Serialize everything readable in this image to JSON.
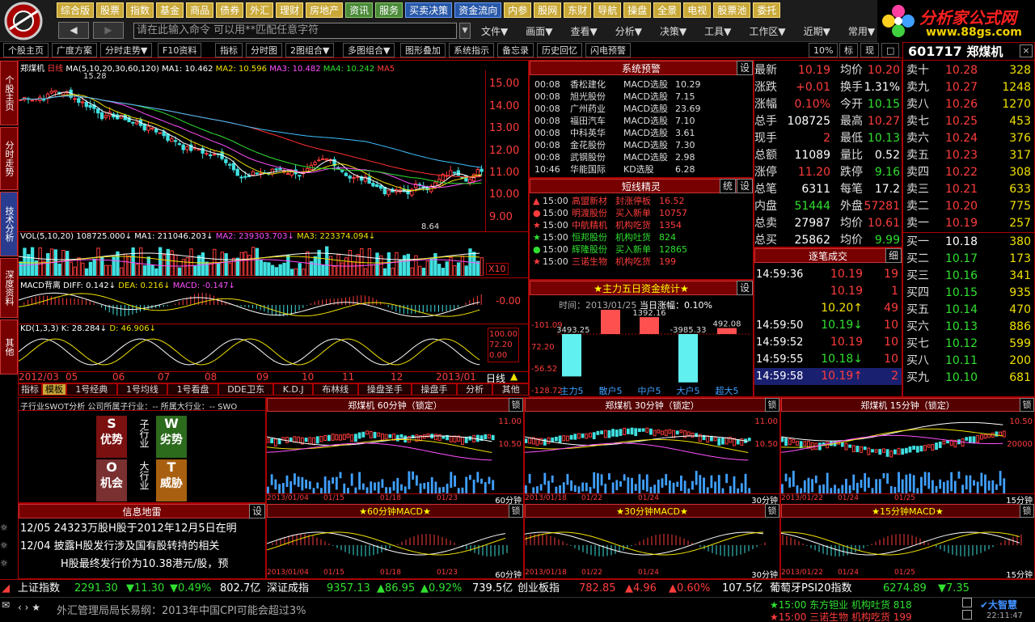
{
  "menu1": [
    "综合版",
    "股票",
    "指数",
    "基金",
    "商品",
    "债券",
    "外汇",
    "理财",
    "房地产",
    "资讯",
    "服务",
    "买卖决策",
    "资金流向",
    "内参",
    "股网",
    "东财",
    "导航",
    "操盘",
    "全景",
    "电视",
    "股票池",
    "委托"
  ],
  "cmd_placeholder": "请在此输入命令   可以用**匹配任意字符",
  "menu2": [
    "文件▼",
    "画面▼",
    "查看▼",
    "分析▼",
    "决策▼",
    "工具▼",
    "工作区▼",
    "近期▼",
    "常用▼"
  ],
  "brand": {
    "title": "分析家公式网",
    "url": "www.88gs.com"
  },
  "toolbar": [
    "个股主页",
    "广度方案",
    "分时走势▼",
    "F10资料",
    "指标",
    "分时图",
    "2图组合▼",
    "多图组合▼",
    "图形叠加",
    "系统指示",
    "备忘录",
    "历史回忆",
    "闪电预警"
  ],
  "tb_right": [
    "10%",
    "标",
    "现",
    "□",
    "×"
  ],
  "vtabs": [
    "个股主页",
    "分时走势",
    "技术分析",
    "深度资料",
    "其他"
  ],
  "kline": {
    "title": "郑煤机",
    "period": "日线",
    "ma_label": "MA(5,10,20,30,60,120)",
    "ma1": "MA1: 10.462",
    "ma2": "MA2: 10.596",
    "ma3": "MA3: 10.482",
    "ma4": "MA4: 10.242",
    "ma5": "MA5",
    "high": "15.28",
    "low": "8.64",
    "yaxis": [
      "15.00",
      "14.00",
      "13.00",
      "12.00",
      "11.00",
      "10.00",
      "9.00"
    ]
  },
  "vol": {
    "label": "VOL(5,10,20)",
    "v": "108725.000↓",
    "ma1": "MA1: 211046.203↓",
    "ma2": "MA2: 239303.703↓",
    "ma3": "MA3: 223374.094↓",
    "x10": "X10"
  },
  "macd": {
    "label": "MACD背离",
    "diff": "DIFF: 0.142↓",
    "dea": "DEA: 0.216↓",
    "m": "MACD: -0.147↓",
    "axis": "-0.00"
  },
  "kd": {
    "label": "KD(1,3,3)",
    "k": "K: 28.284↓",
    "d": "D: 46.906↓",
    "axis": [
      "100.00",
      "72.20",
      "0.00"
    ]
  },
  "dates": [
    "2012/03",
    "05",
    "06",
    "07",
    "08",
    "09",
    "10",
    "11",
    "12",
    "2013/01"
  ],
  "date_suffix": "日线",
  "subtabs": [
    "指标",
    "模板",
    "1号经典",
    "1号均线",
    "1号看盘",
    "DDE卫东",
    "K.D.J",
    "布林线",
    "操盘圣手",
    "操盘手",
    "分析",
    "其他"
  ],
  "alerts": {
    "title": "系统预警",
    "set": "设",
    "rows": [
      [
        "00:08",
        "香松建化",
        "MACD选股",
        "10.29"
      ],
      [
        "00:08",
        "旭光股份",
        "MACD选股",
        "7.15"
      ],
      [
        "00:08",
        "广州药业",
        "MACD选股",
        "23.69"
      ],
      [
        "00:08",
        "福田汽车",
        "MACD选股",
        "7.10"
      ],
      [
        "00:08",
        "中科英华",
        "MACD选股",
        "3.61"
      ],
      [
        "00:08",
        "金花股份",
        "MACD选股",
        "7.30"
      ],
      [
        "00:08",
        "武钢股份",
        "MACD选股",
        "2.98"
      ],
      [
        "10:46",
        "华能国际",
        "KD选股",
        "6.28"
      ]
    ]
  },
  "sprite": {
    "title": "短线精灵",
    "t1": "统",
    "t2": "设",
    "rows": [
      [
        "▲",
        "15:00",
        "高盟新材",
        "封涨停板",
        "16.52",
        "r"
      ],
      [
        "●",
        "15:00",
        "明渡股份",
        "买入新单",
        "10757",
        "r"
      ],
      [
        "★",
        "15:00",
        "中航精机",
        "机构吃货",
        "1354",
        "r"
      ],
      [
        "★",
        "15:00",
        "恒邦股份",
        "机构吐货",
        "824",
        "g"
      ],
      [
        "●",
        "15:00",
        "辉隆股份",
        "买入新单",
        "12865",
        "g"
      ],
      [
        "★",
        "15:00",
        "三诺生物",
        "机构吃货",
        "199",
        "r"
      ]
    ]
  },
  "fund": {
    "title": "★主力五日资金统计★",
    "set": "设",
    "time": "时间：2013/01/25",
    "chg": "当日涨幅：0.10%",
    "yaxis": [
      "-101.09",
      "72.20",
      "-56.52",
      "-128.72"
    ],
    "bars": [
      {
        "label": "主力5",
        "value": -3493.25
      },
      {
        "label": "散户5",
        "value": 2101.09
      },
      {
        "label": "中户5",
        "value": 1392.16
      },
      {
        "label": "大户5",
        "value": -3985.33
      },
      {
        "label": "超大5",
        "value": 492.08
      }
    ]
  },
  "quote": {
    "code": "601717",
    "name": "郑煤机",
    "rows": [
      [
        "最新",
        "10.19",
        "均价",
        "10.20"
      ],
      [
        "涨跌",
        "+0.01",
        "换手",
        "1.31%"
      ],
      [
        "涨幅",
        "0.10%",
        "今开",
        "10.15"
      ],
      [
        "总手",
        "108725",
        "最高",
        "10.27"
      ],
      [
        "现手",
        "2",
        "最低",
        "10.13"
      ],
      [
        "总额",
        "11089",
        "量比",
        "0.52"
      ],
      [
        "涨停",
        "11.20",
        "跌停",
        "9.16"
      ],
      [
        "总笔",
        "6311",
        "每笔",
        "17.2"
      ],
      [
        "内盘",
        "51444",
        "外盘",
        "57281"
      ],
      [
        "总卖",
        "27987",
        "均价",
        "10.61"
      ],
      [
        "总买",
        "25862",
        "均价",
        "9.99"
      ]
    ]
  },
  "book": {
    "sell": [
      [
        "卖十",
        "10.28",
        "328"
      ],
      [
        "卖九",
        "10.27",
        "1248"
      ],
      [
        "卖八",
        "10.26",
        "1270"
      ],
      [
        "卖七",
        "10.25",
        "453"
      ],
      [
        "卖六",
        "10.24",
        "376"
      ],
      [
        "卖五",
        "10.23",
        "317"
      ],
      [
        "卖四",
        "10.22",
        "308"
      ],
      [
        "卖三",
        "10.21",
        "633"
      ],
      [
        "卖二",
        "10.20",
        "775"
      ],
      [
        "卖一",
        "10.19",
        "257"
      ]
    ],
    "buy": [
      [
        "买一",
        "10.18",
        "380"
      ],
      [
        "买二",
        "10.17",
        "173"
      ],
      [
        "买三",
        "10.16",
        "341"
      ],
      [
        "买四",
        "10.15",
        "935"
      ],
      [
        "买五",
        "10.14",
        "470"
      ],
      [
        "买六",
        "10.13",
        "886"
      ],
      [
        "买七",
        "10.12",
        "599"
      ],
      [
        "买八",
        "10.11",
        "200"
      ],
      [
        "买九",
        "10.10",
        "681"
      ]
    ]
  },
  "ticks": {
    "title": "逐笔成交",
    "btn": "细",
    "rows": [
      [
        "14:59:36",
        "10.19",
        "19"
      ],
      [
        "",
        "10.19",
        "1"
      ],
      [
        "",
        "10.20↑",
        "49"
      ],
      [
        "14:59:50",
        "10.19↓",
        "10"
      ],
      [
        "14:59:52",
        "10.19",
        "10"
      ],
      [
        "14:59:55",
        "10.18↓",
        "10"
      ],
      [
        "14:59:58",
        "10.19↑",
        "2"
      ]
    ]
  },
  "swot": {
    "header": "子行业SWOT分析  公司所属子行业：-- 所属大行业：-- SWO",
    "s": [
      "S",
      "优势"
    ],
    "w": [
      "W",
      "劣势"
    ],
    "o": [
      "O",
      "机会"
    ],
    "t": [
      "T",
      "威胁"
    ],
    "sub": "子行业",
    "big": "大行业"
  },
  "minis": [
    {
      "title": "郑煤机  60分钟（锁定）",
      "macd": "★60分钟MACD★",
      "period": "60分钟",
      "yaxis": [
        "11.00",
        "10.50"
      ],
      "dates": [
        "2013/01/04",
        "01/15",
        "01/18",
        "01/23"
      ]
    },
    {
      "title": "郑煤机  30分钟（锁定）",
      "macd": "★30分钟MACD★",
      "period": "30分钟",
      "yaxis": [
        "11.00",
        "10.50"
      ],
      "dates": [
        "2013/01/18",
        "01/22",
        "01/24"
      ]
    },
    {
      "title": "郑煤机  15分钟（锁定）",
      "macd": "★15分钟MACD★",
      "period": "15分钟",
      "yaxis": [
        "10.50",
        "20000"
      ],
      "dates": [
        "2013/01/22",
        "01/24",
        "01/25"
      ]
    }
  ],
  "lock": "锁",
  "news": {
    "title": "信息地雷",
    "set": "设",
    "items": [
      "12/05 24323万股H股于2012年12月5日在明",
      "12/04 披露H股发行涉及国有股转持的相关",
      "H股最终发行价为10.38港元/股，预"
    ]
  },
  "index": {
    "sh": [
      "上证指数",
      "2291.30",
      "▼11.30",
      "▼0.49%",
      "802.7亿"
    ],
    "sz": [
      "深证成指",
      "9357.13",
      "▲86.95",
      "▲0.92%",
      "739.5亿"
    ],
    "cy": [
      "创业板指",
      "782.85",
      "▲4.96",
      "▲0.60%",
      "107.5亿"
    ],
    "pt": [
      "葡萄牙PSI20指数",
      "6274.89",
      "▼7.35"
    ]
  },
  "ticker": {
    "msg": "外汇管理局局长易纲：2013年中国CPI可能会超过3%",
    "a1": "★15:00  东方钽业  机构吐货  818",
    "a2": "★15:00  三诺生物  机构吃货  199",
    "clock": "22:11:47"
  }
}
